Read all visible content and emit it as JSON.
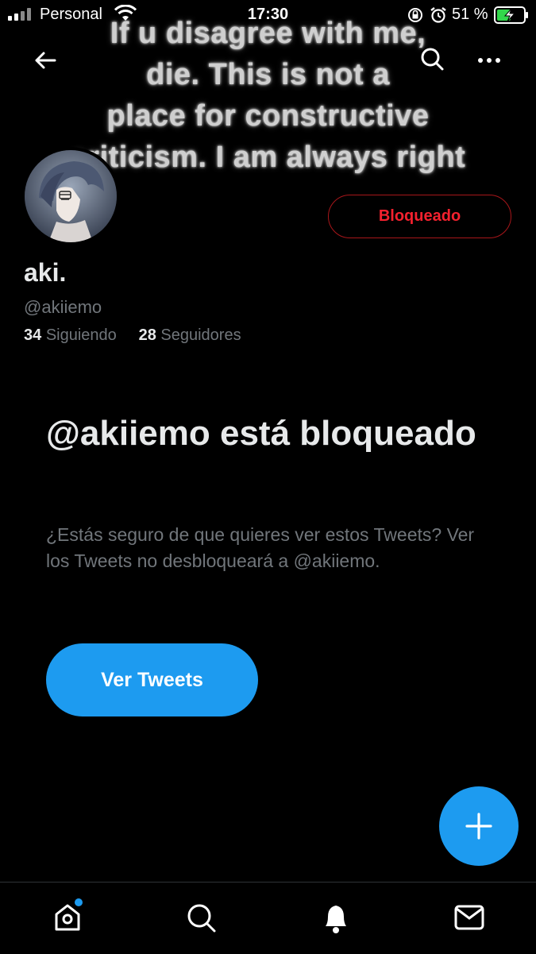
{
  "status_bar": {
    "carrier": "Personal",
    "time": "17:30",
    "battery_percent": "51 %",
    "icons": [
      "signal-icon",
      "wifi-icon",
      "orientation-lock-icon",
      "alarm-icon",
      "battery-charging-icon"
    ]
  },
  "banner": {
    "text": "If u disagree with me,\ndie.    This is not a\nplace for constructive\ncriticism. I am always right"
  },
  "header": {
    "icons": [
      "back-arrow-icon",
      "search-icon",
      "more-icon"
    ]
  },
  "profile": {
    "name": "aki.",
    "handle": "@akiiemo",
    "following_count": "34",
    "following_label": "Siguiendo",
    "followers_count": "28",
    "followers_label": "Seguidores",
    "blocked_button_label": "Bloqueado"
  },
  "blocked_notice": {
    "title": "@akiiemo está bloqueado",
    "description": "¿Estás seguro de que quieres ver estos Tweets? Ver los Tweets no desbloqueará a @akiiemo.",
    "view_button_label": "Ver Tweets"
  },
  "fab": {
    "icon": "plus-icon"
  },
  "bottom_nav": {
    "items": [
      "home-icon",
      "search-icon",
      "notifications-icon",
      "messages-icon"
    ],
    "accent": "#1d9bf0"
  },
  "colors": {
    "accent": "#1d9bf0",
    "blocked_red": "#f4212e",
    "background": "#000000"
  }
}
